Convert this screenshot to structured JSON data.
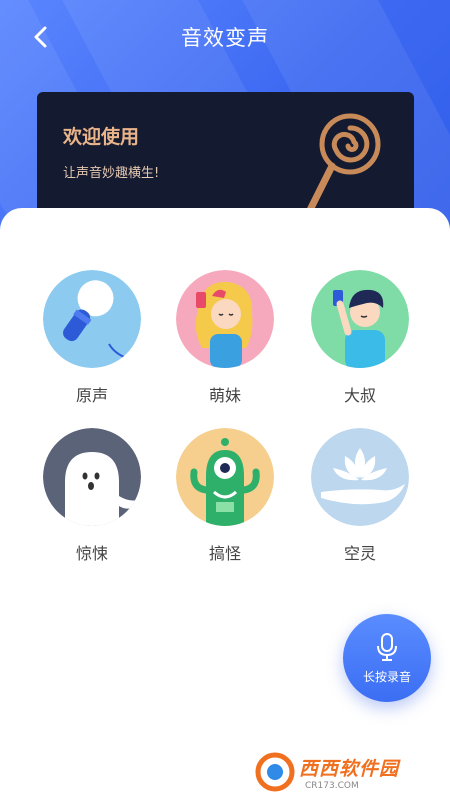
{
  "header": {
    "title": "音效变声"
  },
  "banner": {
    "title": "欢迎使用",
    "subtitle": "让声音妙趣横生!"
  },
  "effects": [
    {
      "label": "原声",
      "icon": "microphone-icon"
    },
    {
      "label": "萌妹",
      "icon": "cute-girl-icon"
    },
    {
      "label": "大叔",
      "icon": "uncle-icon"
    },
    {
      "label": "惊悚",
      "icon": "ghost-icon"
    },
    {
      "label": "搞怪",
      "icon": "monster-icon"
    },
    {
      "label": "空灵",
      "icon": "lotus-icon"
    }
  ],
  "record_button": {
    "label": "长按录音"
  },
  "watermark": {
    "main": "西西软件园",
    "sub": "CR173.COM"
  },
  "colors": {
    "accent": "#3d69f2",
    "banner_bg": "#141a30",
    "banner_title": "#e9b48a"
  }
}
